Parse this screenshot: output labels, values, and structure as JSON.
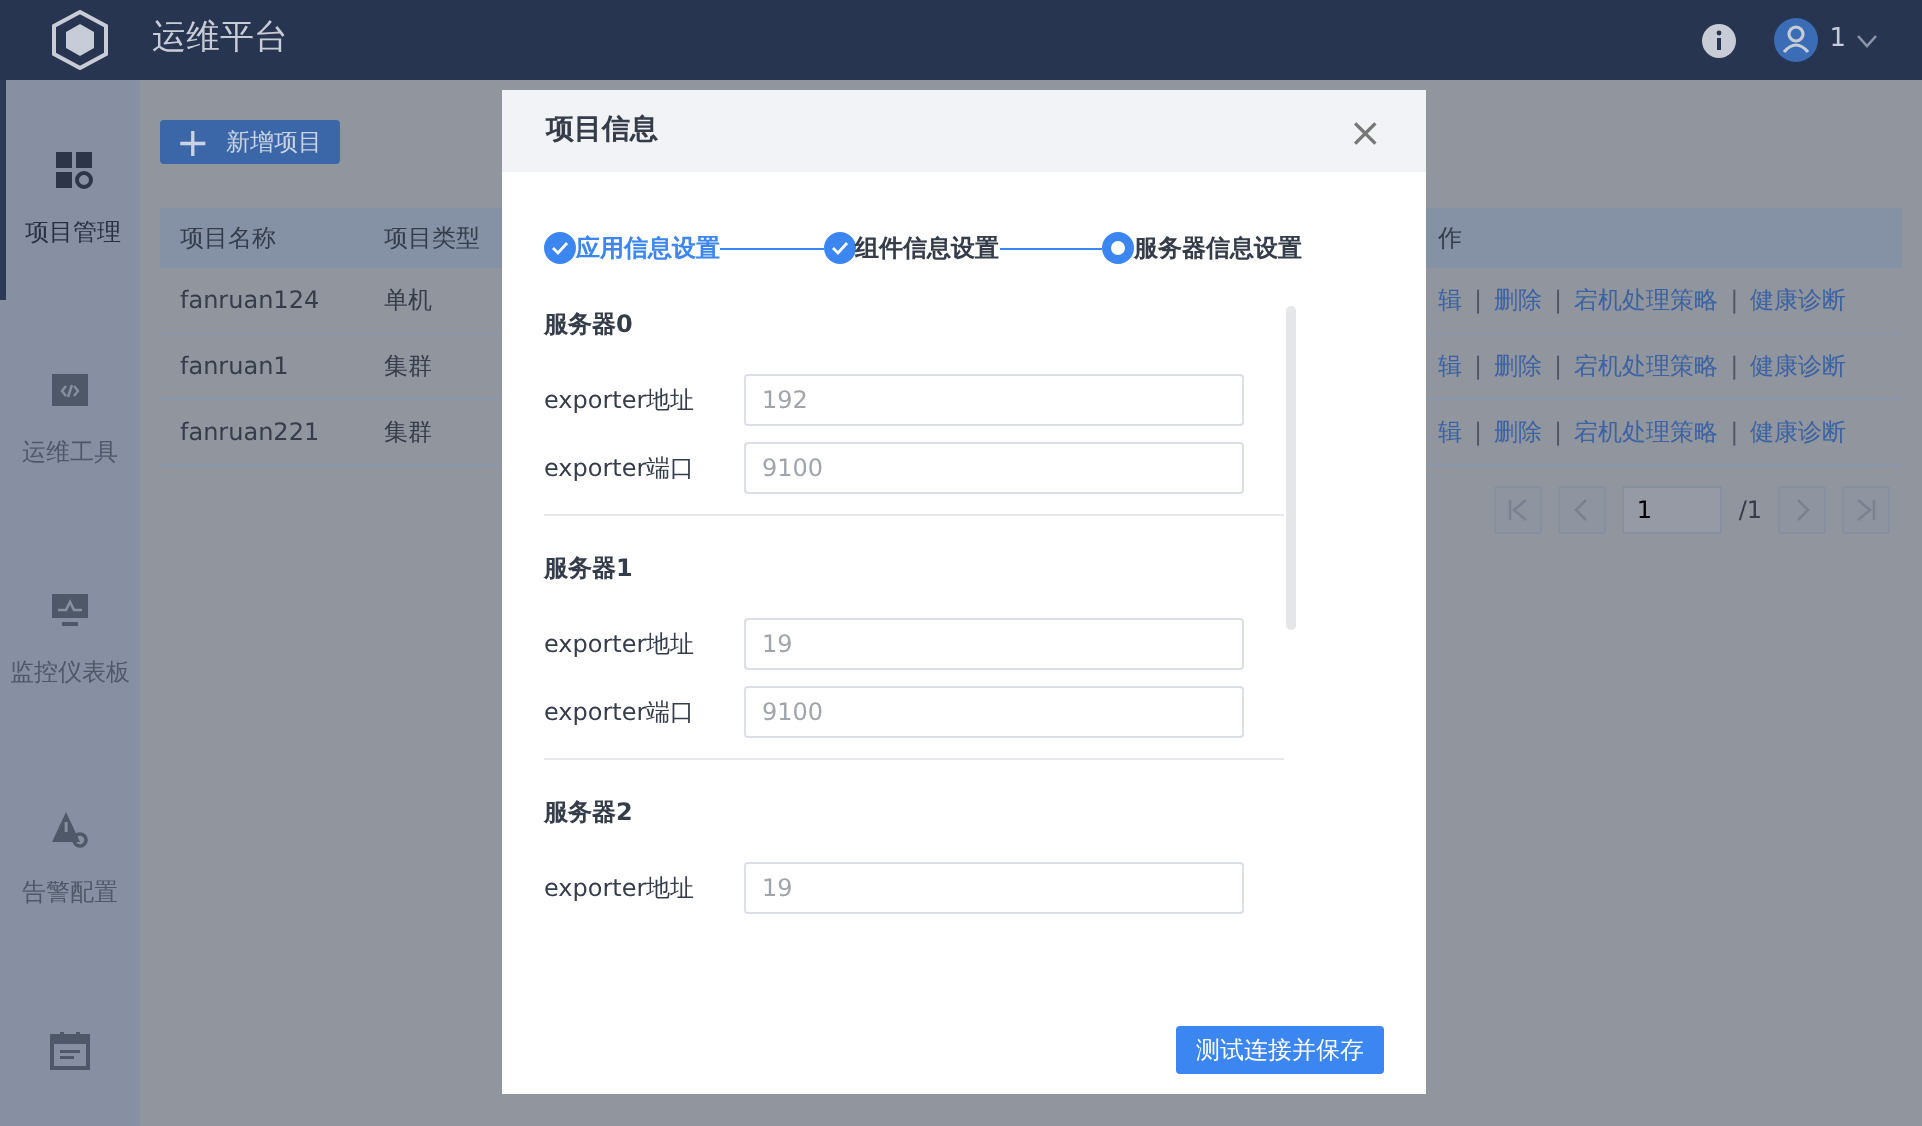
{
  "header": {
    "title": "运维平台",
    "user": "1"
  },
  "sidebar": {
    "items": [
      {
        "label": "项目管理",
        "selected": true
      },
      {
        "label": "运维工具",
        "selected": false
      },
      {
        "label": "监控仪表板",
        "selected": false
      },
      {
        "label": "告警配置",
        "selected": false
      },
      {
        "selected": false
      }
    ]
  },
  "add_button": {
    "label": "新增项目",
    "icon": "+"
  },
  "table": {
    "columns": [
      "项目名称",
      "项目类型",
      "作"
    ],
    "rows": [
      {
        "cells": [
          "fanruan124",
          "单机"
        ],
        "actions": [
          {
            "kind": "link",
            "text": "辑"
          },
          {
            "kind": "separator",
            "text": "|"
          },
          {
            "kind": "link",
            "text": "删除"
          },
          {
            "kind": "separator",
            "text": "|"
          },
          {
            "kind": "link",
            "text": "宕机处理策略"
          },
          {
            "kind": "separator",
            "text": "|"
          },
          {
            "kind": "link",
            "text": "健康诊断"
          }
        ]
      },
      {
        "cells": [
          "fanruan1",
          "集群"
        ],
        "actions": [
          {
            "kind": "link",
            "text": "辑"
          },
          {
            "kind": "separator",
            "text": "|"
          },
          {
            "kind": "link",
            "text": "删除"
          },
          {
            "kind": "separator",
            "text": "|"
          },
          {
            "kind": "link",
            "text": "宕机处理策略"
          },
          {
            "kind": "separator",
            "text": "|"
          },
          {
            "kind": "link",
            "text": "健康诊断"
          }
        ]
      },
      {
        "cells": [
          "fanruan221",
          "集群"
        ],
        "actions": [
          {
            "kind": "link",
            "text": "辑"
          },
          {
            "kind": "separator",
            "text": "|"
          },
          {
            "kind": "link",
            "text": "删除"
          },
          {
            "kind": "separator",
            "text": "|"
          },
          {
            "kind": "link",
            "text": "宕机处理策略"
          },
          {
            "kind": "separator",
            "text": "|"
          },
          {
            "kind": "link",
            "text": "健康诊断"
          }
        ]
      }
    ]
  },
  "pagination": {
    "page": "1",
    "total": "/1"
  },
  "modal": {
    "title": "项目信息",
    "close": "×",
    "steps": [
      {
        "label": "应用信息设置",
        "done": true,
        "selected": true
      },
      {
        "label": "组件信息设置",
        "done": true,
        "selected": false
      },
      {
        "label": "服务器信息设置",
        "done": false,
        "selected": false
      }
    ],
    "servers": [
      {
        "title": "服务器0",
        "fields": [
          {
            "label": "exporter地址",
            "value": "192"
          },
          {
            "label": "exporter端口",
            "value": "9100"
          }
        ]
      },
      {
        "title": "服务器1",
        "fields": [
          {
            "label": "exporter地址",
            "value": "19"
          },
          {
            "label": "exporter端口",
            "value": "9100"
          }
        ]
      },
      {
        "title": "服务器2",
        "fields": [
          {
            "label": "exporter地址",
            "value": "19"
          }
        ]
      }
    ],
    "submit": "测试连接并保存"
  }
}
